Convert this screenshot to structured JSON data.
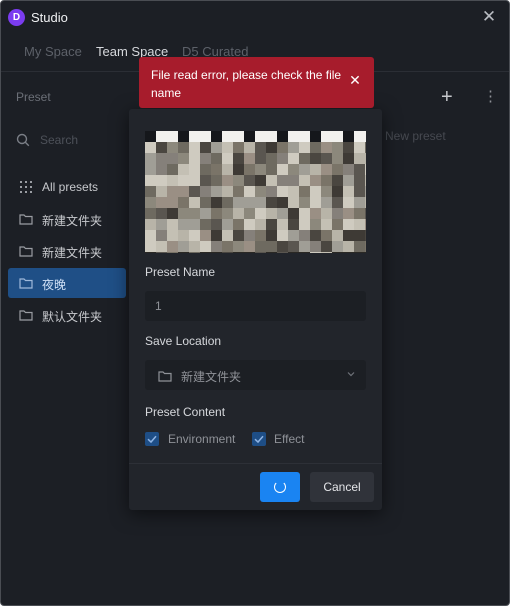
{
  "window": {
    "app_title": "Studio",
    "logo_letter": "D",
    "close_glyph": "✕"
  },
  "tabs": [
    {
      "label": "My Space"
    },
    {
      "label": "Team Space"
    },
    {
      "label": "D5 Curated"
    }
  ],
  "sidebar": {
    "title": "Preset",
    "search_placeholder": "Search",
    "items": [
      {
        "label": "All presets",
        "icon": "grid-icon"
      },
      {
        "label": "新建文件夹",
        "icon": "folder-icon"
      },
      {
        "label": "新建文件夹",
        "icon": "folder-icon"
      },
      {
        "label": "夜晚",
        "icon": "folder-icon",
        "selected": true
      },
      {
        "label": "默认文件夹",
        "icon": "folder-icon"
      }
    ]
  },
  "toolbar": {
    "add_glyph": "+",
    "more_glyph": "⋮"
  },
  "main": {
    "new_preset_label": "New preset"
  },
  "dialog": {
    "preset_name_label": "Preset Name",
    "preset_name_value": "1",
    "save_location_label": "Save Location",
    "save_location_value": "新建文件夹",
    "preset_content_label": "Preset Content",
    "checkboxes": [
      {
        "label": "Environment",
        "checked": true
      },
      {
        "label": "Effect",
        "checked": true
      }
    ],
    "cancel_label": "Cancel",
    "confirm_state": "loading"
  },
  "toast": {
    "message": "File read error, please check the file name",
    "close_glyph": "✕",
    "color": "#a71c2c"
  },
  "colors": {
    "accent": "#1a84f2",
    "selected_item": "#1f4f86",
    "background": "#1c1f25"
  }
}
